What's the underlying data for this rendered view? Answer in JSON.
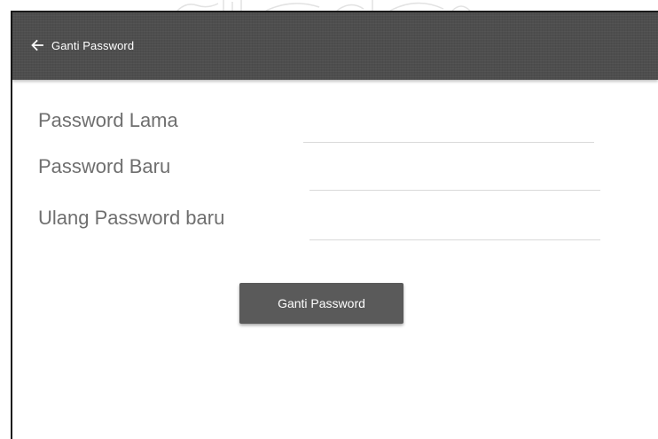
{
  "app_bar": {
    "title": "Ganti Password",
    "back_icon": "arrow-left-icon",
    "background": "#4e4e4e",
    "title_color": "#ffffff"
  },
  "form": {
    "old_password": {
      "label": "Password Lama",
      "value": "",
      "placeholder": ""
    },
    "new_password": {
      "label": "Password Baru",
      "value": "",
      "placeholder": ""
    },
    "confirm_password": {
      "label": "Ulang Password baru",
      "value": "",
      "placeholder": ""
    },
    "label_color": "#6f6f6f",
    "underline_color": "#d9d9d9"
  },
  "submit": {
    "label": "Ganti Password",
    "background": "#5a5a5a"
  }
}
